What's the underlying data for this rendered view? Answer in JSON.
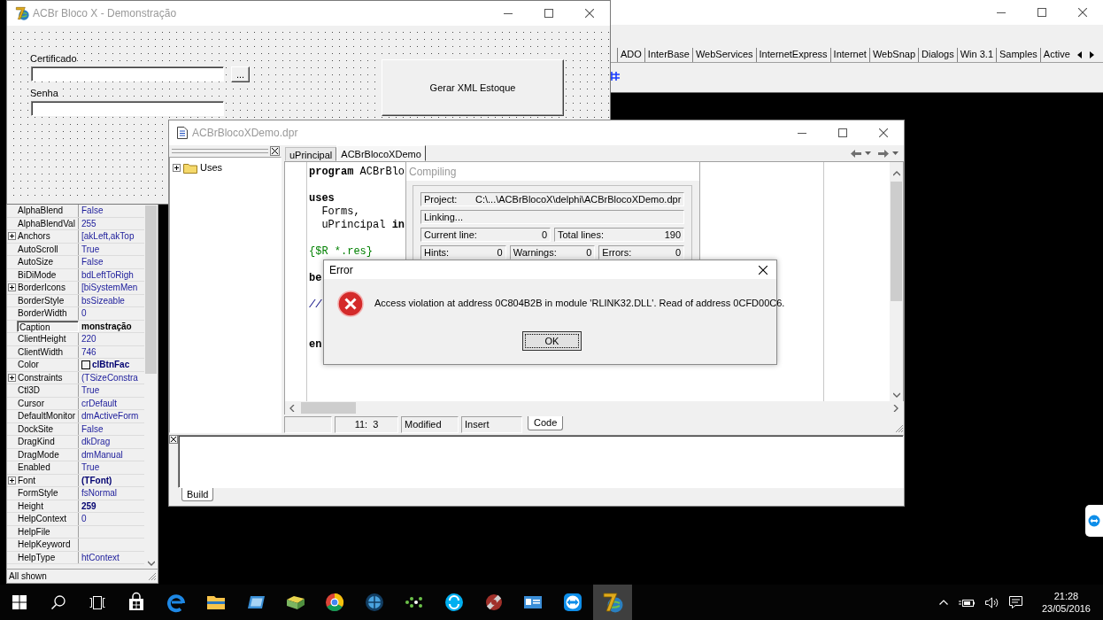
{
  "form_window": {
    "title": "ACBr Bloco X - Demonstração",
    "active": false,
    "fields": [
      {
        "label": "Certificado",
        "kind": "browse",
        "button": "..."
      },
      {
        "label": "Senha",
        "kind": "plain"
      }
    ],
    "action_button": "Gerar XML Estoque"
  },
  "palette_window": {
    "tabs": [
      {
        "label": "ADO",
        "selected": false
      },
      {
        "label": "InterBase",
        "selected": false
      },
      {
        "label": "WebServices",
        "selected": false
      },
      {
        "label": "InternetExpress",
        "selected": false
      },
      {
        "label": "Internet",
        "selected": false
      },
      {
        "label": "WebSnap",
        "selected": false
      },
      {
        "label": "Dialogs",
        "selected": false
      },
      {
        "label": "Win 3.1",
        "selected": false
      },
      {
        "label": "Samples",
        "selected": false
      },
      {
        "label": "Active",
        "selected": false
      }
    ]
  },
  "object_inspector": {
    "properties": [
      {
        "name": "AlphaBlend",
        "value": "False",
        "kind": "plain",
        "selected": false,
        "modified": false
      },
      {
        "name": "AlphaBlendVal",
        "value": "255",
        "kind": "plain",
        "selected": false,
        "modified": false
      },
      {
        "name": "Anchors",
        "value": "[akLeft,akTop",
        "kind": "expandable",
        "selected": false,
        "modified": false
      },
      {
        "name": "AutoScroll",
        "value": "True",
        "kind": "plain",
        "selected": false,
        "modified": false
      },
      {
        "name": "AutoSize",
        "value": "False",
        "kind": "plain",
        "selected": false,
        "modified": false
      },
      {
        "name": "BiDiMode",
        "value": "bdLeftToRigh",
        "kind": "plain",
        "selected": false,
        "modified": false
      },
      {
        "name": "BorderIcons",
        "value": "[biSystemMen",
        "kind": "expandable",
        "selected": false,
        "modified": false
      },
      {
        "name": "BorderStyle",
        "value": "bsSizeable",
        "kind": "plain",
        "selected": false,
        "modified": false
      },
      {
        "name": "BorderWidth",
        "value": "0",
        "kind": "plain",
        "selected": false,
        "modified": false
      },
      {
        "name": "Caption",
        "value": "monstração",
        "kind": "plain",
        "selected": true,
        "modified": true
      },
      {
        "name": "ClientHeight",
        "value": "220",
        "kind": "plain",
        "selected": false,
        "modified": false
      },
      {
        "name": "ClientWidth",
        "value": "746",
        "kind": "plain",
        "selected": false,
        "modified": false
      },
      {
        "name": "Color",
        "value": "clBtnFac",
        "kind": "color",
        "selected": false,
        "modified": true
      },
      {
        "name": "Constraints",
        "value": "(TSizeConstra",
        "kind": "expandable",
        "selected": false,
        "modified": false
      },
      {
        "name": "Ctl3D",
        "value": "True",
        "kind": "plain",
        "selected": false,
        "modified": false
      },
      {
        "name": "Cursor",
        "value": "crDefault",
        "kind": "plain",
        "selected": false,
        "modified": false
      },
      {
        "name": "DefaultMonitor",
        "value": "dmActiveForm",
        "kind": "plain",
        "selected": false,
        "modified": false
      },
      {
        "name": "DockSite",
        "value": "False",
        "kind": "plain",
        "selected": false,
        "modified": false
      },
      {
        "name": "DragKind",
        "value": "dkDrag",
        "kind": "plain",
        "selected": false,
        "modified": false
      },
      {
        "name": "DragMode",
        "value": "dmManual",
        "kind": "plain",
        "selected": false,
        "modified": false
      },
      {
        "name": "Enabled",
        "value": "True",
        "kind": "plain",
        "selected": false,
        "modified": false
      },
      {
        "name": "Font",
        "value": "(TFont)",
        "kind": "expandable",
        "selected": false,
        "modified": true
      },
      {
        "name": "FormStyle",
        "value": "fsNormal",
        "kind": "plain",
        "selected": false,
        "modified": false
      },
      {
        "name": "Height",
        "value": "259",
        "kind": "plain",
        "selected": false,
        "modified": true
      },
      {
        "name": "HelpContext",
        "value": "0",
        "kind": "plain",
        "selected": false,
        "modified": false
      },
      {
        "name": "HelpFile",
        "kind": "plain",
        "selected": false
      },
      {
        "name": "HelpKeyword",
        "kind": "plain",
        "selected": false
      },
      {
        "name": "HelpType",
        "value": "htContext",
        "kind": "plain",
        "selected": false,
        "modified": false
      }
    ],
    "status": "All shown"
  },
  "editor_window": {
    "title": "ACBrBlocoXDemo.dpr",
    "active": false,
    "tree": [
      {
        "label": "Uses",
        "expanded": false
      }
    ],
    "tabs": [
      {
        "label": "uPrincipal",
        "selected": false
      },
      {
        "label": "ACBrBlocoXDemo",
        "selected": true
      }
    ],
    "code_lines": [
      {
        "kind": "code",
        "segments": [
          {
            "kind": "keyword",
            "text": "program"
          },
          {
            "kind": "plain",
            "text": " ACBrBlo"
          }
        ]
      },
      {
        "kind": "blank"
      },
      {
        "kind": "code",
        "segments": [
          {
            "kind": "keyword",
            "text": "uses"
          }
        ]
      },
      {
        "kind": "code",
        "segments": [
          {
            "kind": "plain",
            "text": "  Forms,"
          }
        ]
      },
      {
        "kind": "code",
        "segments": [
          {
            "kind": "plain",
            "text": "  uPrincipal "
          },
          {
            "kind": "keyword",
            "text": "in"
          }
        ]
      },
      {
        "kind": "blank"
      },
      {
        "kind": "code",
        "segments": [
          {
            "kind": "directive",
            "text": "{$R *.res}"
          }
        ]
      },
      {
        "kind": "blank"
      },
      {
        "kind": "code",
        "segments": [
          {
            "kind": "keyword",
            "text": "be"
          }
        ]
      },
      {
        "kind": "blank"
      },
      {
        "kind": "code",
        "segments": [
          {
            "kind": "comment",
            "text": "//"
          }
        ]
      },
      {
        "kind": "blank"
      },
      {
        "kind": "blank"
      },
      {
        "kind": "code",
        "segments": [
          {
            "kind": "keyword",
            "text": "en"
          }
        ]
      }
    ],
    "status": {
      "position": "11:  3",
      "modified": "Modified",
      "mode": "Insert"
    },
    "view_tabs": [
      {
        "label": "Code",
        "selected": true
      }
    ],
    "message_tabs": [
      {
        "label": "Build",
        "selected": true
      }
    ]
  },
  "compiling_dialog": {
    "title": "Compiling",
    "active": false,
    "project": {
      "label": "Project:",
      "value": "C:\\...\\ACBrBlocoX\\delphi\\ACBrBlocoXDemo.dpr"
    },
    "status": "Linking...",
    "counter_rows": [
      {
        "counters": [
          {
            "label": "Current line:",
            "value": "0"
          },
          {
            "label": "Total lines:",
            "value": "190"
          }
        ]
      },
      {
        "counters": [
          {
            "label": "Hints:",
            "value": "0"
          },
          {
            "label": "Warnings:",
            "value": "0"
          },
          {
            "label": "Errors:",
            "value": "0"
          }
        ]
      }
    ]
  },
  "error_dialog": {
    "title": "Error",
    "active": true,
    "message": "Access violation at address 0C804B2B in module 'RLINK32.DLL'. Read of address 0CFD00C6.",
    "buttons": [
      {
        "label": "OK",
        "focused": true
      }
    ]
  },
  "taskbar": {
    "apps": [
      {
        "selected": false
      },
      {
        "selected": false
      },
      {
        "selected": false
      },
      {
        "selected": false
      },
      {
        "selected": false
      },
      {
        "selected": false
      },
      {
        "selected": false
      },
      {
        "selected": false
      },
      {
        "selected": false
      },
      {
        "selected": false
      },
      {
        "selected": false
      },
      {
        "selected": false
      },
      {
        "selected": true
      }
    ],
    "clock": {
      "time": "21:28",
      "date": "23/05/2016"
    }
  }
}
